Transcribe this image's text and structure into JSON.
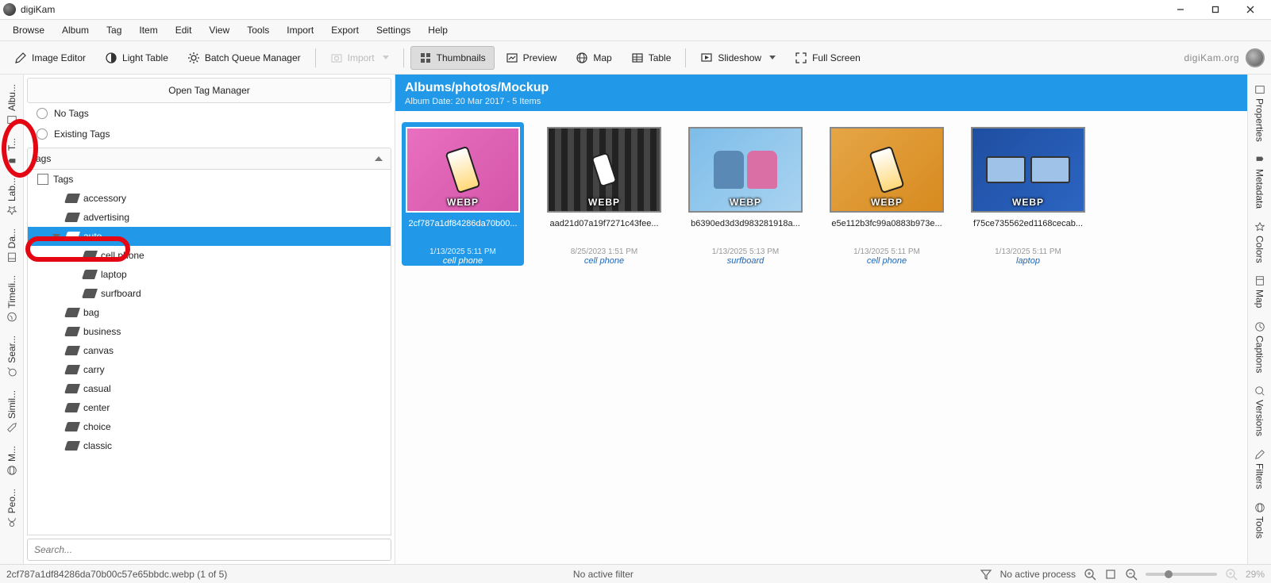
{
  "window": {
    "title": "digiKam"
  },
  "menubar": [
    "Browse",
    "Album",
    "Tag",
    "Item",
    "Edit",
    "View",
    "Tools",
    "Import",
    "Export",
    "Settings",
    "Help"
  ],
  "toolbar": {
    "image_editor": "Image Editor",
    "light_table": "Light Table",
    "batch_queue": "Batch Queue Manager",
    "import": "Import",
    "thumbnails": "Thumbnails",
    "preview": "Preview",
    "map": "Map",
    "table": "Table",
    "slideshow": "Slideshow",
    "full_screen": "Full Screen",
    "brand": "digiKam.org"
  },
  "left_tabs": [
    "Albu...",
    "T...",
    "Lab...",
    "Da...",
    "Timeli...",
    "Sear...",
    "Simil...",
    "M...",
    "Peo..."
  ],
  "right_tabs": [
    "Properties",
    "Metadata",
    "Colors",
    "Map",
    "Captions",
    "Versions",
    "Filters",
    "Tools"
  ],
  "sidebar": {
    "open_tag_manager": "Open Tag Manager",
    "no_tags": "No Tags",
    "existing_tags": "Existing Tags",
    "filter_field": "ags",
    "root_label": "Tags",
    "search_placeholder": "Search...",
    "tags": [
      {
        "label": "accessory",
        "level": 1
      },
      {
        "label": "advertising",
        "level": 1
      },
      {
        "label": "auto",
        "level": 1,
        "selected": true,
        "expanded": true
      },
      {
        "label": "cell phone",
        "level": 2
      },
      {
        "label": "laptop",
        "level": 2
      },
      {
        "label": "surfboard",
        "level": 2
      },
      {
        "label": "bag",
        "level": 1
      },
      {
        "label": "business",
        "level": 1
      },
      {
        "label": "canvas",
        "level": 1
      },
      {
        "label": "carry",
        "level": 1
      },
      {
        "label": "casual",
        "level": 1
      },
      {
        "label": "center",
        "level": 1
      },
      {
        "label": "choice",
        "level": 1
      },
      {
        "label": "classic",
        "level": 1
      }
    ]
  },
  "album_header": {
    "title": "Albums/photos/Mockup",
    "subtitle": "Album Date: 20 Mar 2017 - 5 Items"
  },
  "thumb_badge": "WEBP",
  "thumbs": [
    {
      "name": "2cf787a1df84286da70b00...",
      "date": "1/13/2025 5:11 PM",
      "tag": "cell phone",
      "selected": true,
      "bg": "bg-pink",
      "obj": "phone"
    },
    {
      "name": "aad21d07a19f7271c43fee...",
      "date": "8/25/2023 1:51 PM",
      "tag": "cell phone",
      "bg": "bg-grey",
      "obj": "phone-small"
    },
    {
      "name": "b6390ed3d3d983281918a...",
      "date": "1/13/2025 5:13 PM",
      "tag": "surfboard",
      "bg": "bg-lblue",
      "obj": "bags"
    },
    {
      "name": "e5e112b3fc99a0883b973e...",
      "date": "1/13/2025 5:11 PM",
      "tag": "cell phone",
      "bg": "bg-orange",
      "obj": "phone"
    },
    {
      "name": "f75ce735562ed1168cecab...",
      "date": "1/13/2025 5:11 PM",
      "tag": "laptop",
      "bg": "bg-blue",
      "obj": "laptops"
    }
  ],
  "statusbar": {
    "filename": "2cf787a1df84286da70b00c57e65bbdc.webp (1 of 5)",
    "filter": "No active filter",
    "process": "No active process",
    "zoom": "29%"
  }
}
